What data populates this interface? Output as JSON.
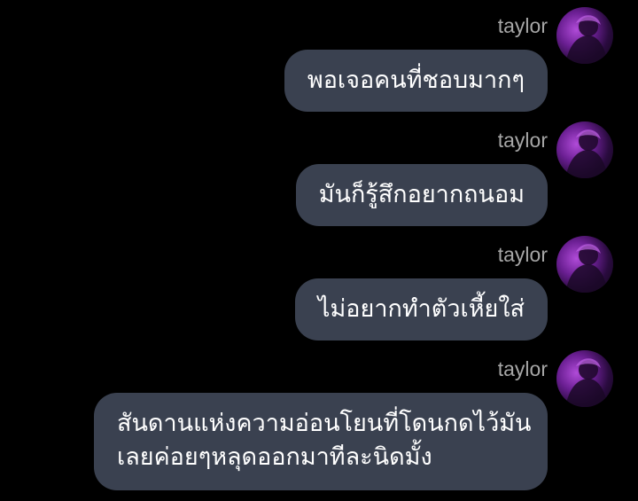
{
  "messages": [
    {
      "sender": "taylor",
      "avatar_icon": "profile-avatar-purple",
      "lines": [
        "พอเจอคนที่ชอบมากๆ"
      ]
    },
    {
      "sender": "taylor",
      "avatar_icon": "profile-avatar-purple",
      "lines": [
        "มันก็รู้สึกอยากถนอม"
      ]
    },
    {
      "sender": "taylor",
      "avatar_icon": "profile-avatar-purple",
      "lines": [
        "ไม่อยากทำตัวเหี้ยใส่"
      ]
    },
    {
      "sender": "taylor",
      "avatar_icon": "profile-avatar-purple",
      "lines": [
        "สันดานแห่งความอ่อนโยนที่โดนกดไว้มัน",
        "เลยค่อยๆหลุดออกมาทีละนิดมั้ง"
      ]
    }
  ],
  "colors": {
    "background": "#000000",
    "bubble": "#3a4150",
    "sender_text": "#a6a6a6",
    "message_text": "#ffffff"
  }
}
